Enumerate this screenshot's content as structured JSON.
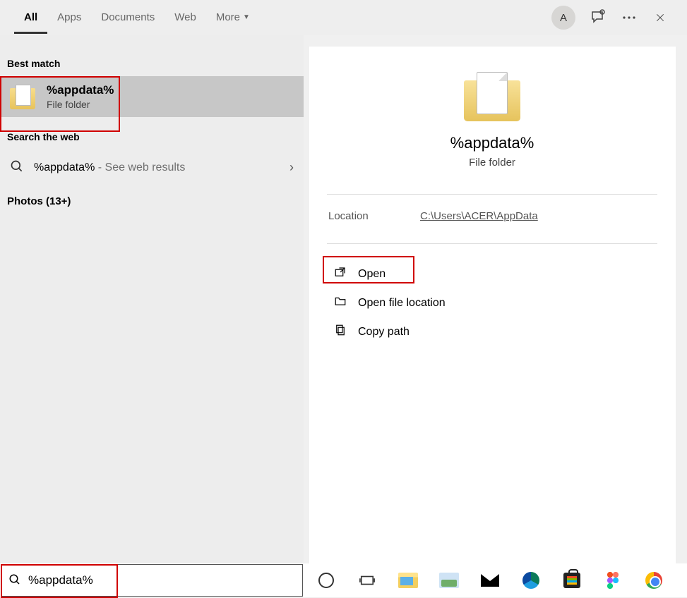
{
  "tabs": [
    {
      "label": "All",
      "active": true
    },
    {
      "label": "Apps",
      "active": false
    },
    {
      "label": "Documents",
      "active": false
    },
    {
      "label": "Web",
      "active": false
    },
    {
      "label": "More",
      "active": false
    }
  ],
  "avatar_letter": "A",
  "sections": {
    "best_match": "Best match",
    "search_web": "Search the web",
    "photos": "Photos (13+)"
  },
  "best_match_item": {
    "title": "%appdata%",
    "subtitle": "File folder"
  },
  "web_result": {
    "query": "%appdata%",
    "suffix": " - See web results"
  },
  "preview": {
    "title": "%appdata%",
    "subtitle": "File folder",
    "location_label": "Location",
    "location_value": "C:\\Users\\ACER\\AppData"
  },
  "actions": {
    "open": "Open",
    "open_location": "Open file location",
    "copy_path": "Copy path"
  },
  "search_input_value": "%appdata%"
}
